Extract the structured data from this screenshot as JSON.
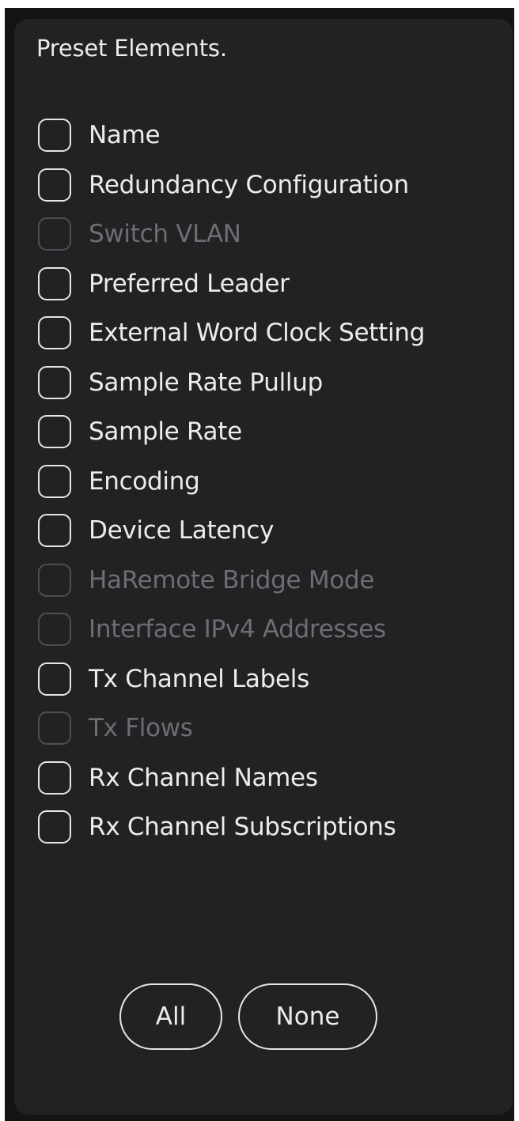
{
  "panel": {
    "title": "Preset Elements."
  },
  "items": [
    {
      "label": "Name",
      "checked": false,
      "enabled": true
    },
    {
      "label": "Redundancy Configuration",
      "checked": false,
      "enabled": true
    },
    {
      "label": "Switch VLAN",
      "checked": false,
      "enabled": false
    },
    {
      "label": "Preferred Leader",
      "checked": false,
      "enabled": true
    },
    {
      "label": "External Word Clock Setting",
      "checked": false,
      "enabled": true
    },
    {
      "label": "Sample Rate Pullup",
      "checked": false,
      "enabled": true
    },
    {
      "label": "Sample Rate",
      "checked": false,
      "enabled": true
    },
    {
      "label": "Encoding",
      "checked": false,
      "enabled": true
    },
    {
      "label": "Device Latency",
      "checked": false,
      "enabled": true
    },
    {
      "label": "HaRemote Bridge Mode",
      "checked": false,
      "enabled": false
    },
    {
      "label": "Interface IPv4 Addresses",
      "checked": false,
      "enabled": false
    },
    {
      "label": "Tx Channel Labels",
      "checked": false,
      "enabled": true
    },
    {
      "label": "Tx Flows",
      "checked": false,
      "enabled": false
    },
    {
      "label": "Rx Channel Names",
      "checked": false,
      "enabled": true
    },
    {
      "label": "Rx Channel Subscriptions",
      "checked": false,
      "enabled": true
    }
  ],
  "buttons": {
    "all_label": "All",
    "none_label": "None"
  },
  "colors": {
    "panel_background": "#222224",
    "text": "#ececee",
    "disabled_text": "#6e6e72"
  }
}
